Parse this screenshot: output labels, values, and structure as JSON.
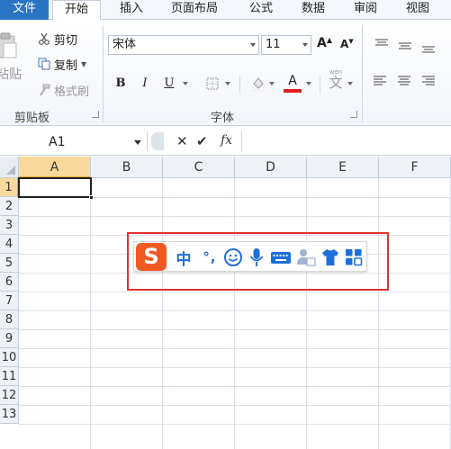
{
  "tabs": [
    {
      "label": "文件"
    },
    {
      "label": "开始"
    },
    {
      "label": "插入"
    },
    {
      "label": "页面布局"
    },
    {
      "label": "公式"
    },
    {
      "label": "数据"
    },
    {
      "label": "审阅"
    },
    {
      "label": "视图"
    }
  ],
  "clipboard": {
    "paste_label": "粘贴",
    "cut_label": "剪切",
    "copy_label": "复制",
    "format_painter_label": "格式刷",
    "group_label": "剪贴板"
  },
  "font": {
    "name": "宋体",
    "size": "11",
    "grow_label": "A",
    "shrink_label": "A",
    "bold": "B",
    "italic": "I",
    "underline": "U",
    "font_color_label": "A",
    "wen_label": "wén",
    "wen_char": "文",
    "group_label": "字体",
    "font_color": "#e0201b"
  },
  "formula_bar": {
    "name_box": "A1",
    "cancel": "✕",
    "enter": "✔",
    "fx": "fx",
    "content": ""
  },
  "grid": {
    "columns": [
      "A",
      "B",
      "C",
      "D",
      "E",
      "F"
    ],
    "rows": [
      "1",
      "2",
      "3",
      "4",
      "5",
      "6",
      "7",
      "8",
      "9",
      "10",
      "11",
      "12",
      "13"
    ],
    "selected_cell": "A1"
  },
  "ime_toolbar": {
    "logo": "S",
    "mode_label": "中",
    "punct_label": "°,",
    "icons": [
      "emoji-icon",
      "microphone-icon",
      "keyboard-icon",
      "user-card-icon",
      "tshirt-icon",
      "grid-apps-icon"
    ],
    "brand_color": "#f05a22",
    "icon_color": "#1e6fd9",
    "highlight_color": "#e03131"
  }
}
